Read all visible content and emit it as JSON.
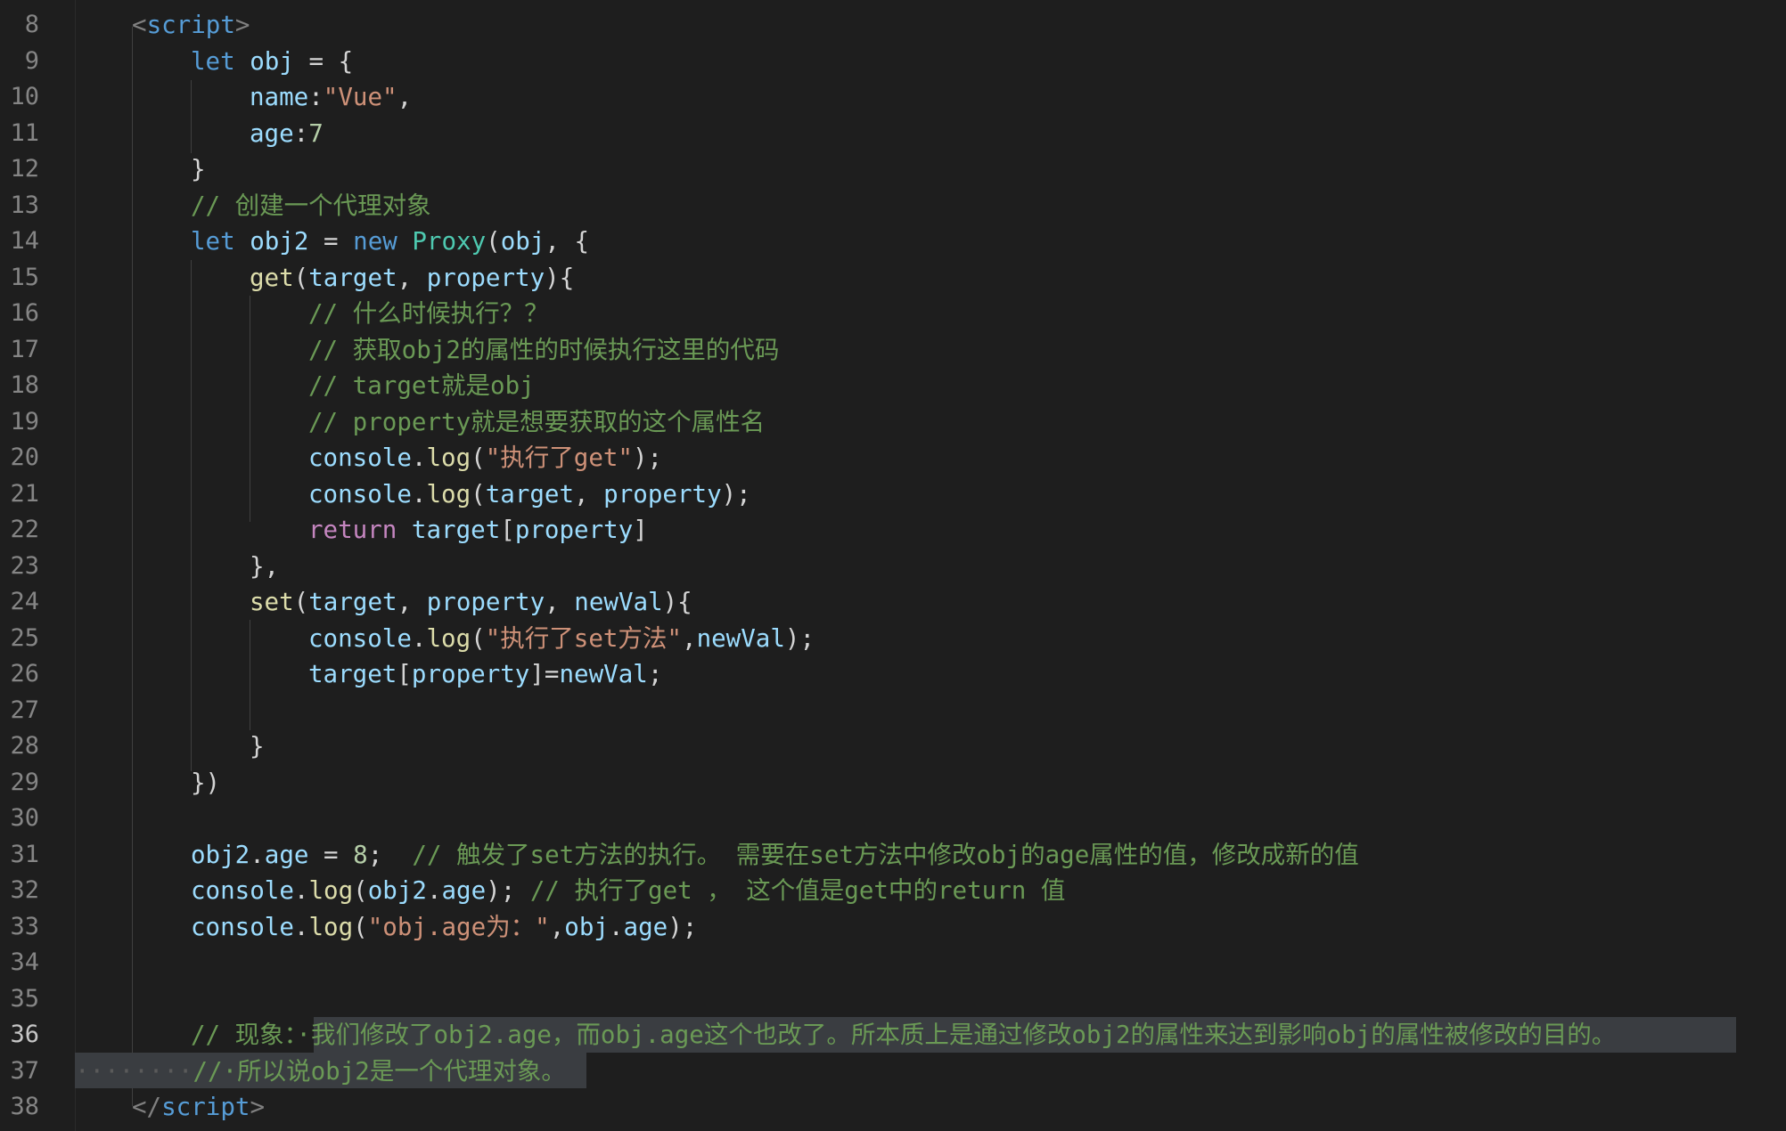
{
  "line_numbers": [
    "8",
    "9",
    "10",
    "11",
    "12",
    "13",
    "14",
    "15",
    "16",
    "17",
    "18",
    "19",
    "20",
    "21",
    "22",
    "23",
    "24",
    "25",
    "26",
    "27",
    "28",
    "29",
    "30",
    "31",
    "32",
    "33",
    "34",
    "35",
    "36",
    "37",
    "38"
  ],
  "active_line": "36",
  "code": {
    "l8_tag": "script",
    "l8_open": "<",
    "l8_close": ">",
    "let": "let",
    "obj": "obj",
    "eq_brace": " = {",
    "name_key": "name",
    "colon": ":",
    "vue_str": "\"Vue\"",
    "comma": ",",
    "age_key": "age",
    "age_val": "7",
    "close_brace": "}",
    "c13": "// 创建一个代理对象",
    "obj2": "obj2",
    "eq": " = ",
    "new_kw": "new",
    "proxy": "Proxy",
    "proxy_args_open": "(",
    "proxy_args_rest": ", {",
    "get_fn": "get",
    "target": "target",
    "property": "property",
    "get_params_open": "(",
    "params_sep": ", ",
    "get_params_close": "){",
    "c16": "// 什么时候执行？？",
    "c17": "// 获取obj2的属性的时候执行这里的代码",
    "c18": "// target就是obj",
    "c19": "// property就是想要获取的这个属性名",
    "console": "console",
    "dot": ".",
    "log": "log",
    "paren_open": "(",
    "paren_close_semi": ");",
    "s20": "\"执行了get\"",
    "return_kw": "return",
    "bracket_open": "[",
    "bracket_close": "]",
    "l23": "},",
    "set_fn": "set",
    "newVal": "newVal",
    "set_params_close": "){",
    "s25": "\"执行了set方法\"",
    "eq_tight": "=",
    "semi": ";",
    "l29": "})",
    "age_prop": "age",
    "eight": "8",
    "c31": "// 触发了set方法的执行。 需要在set方法中修改obj的age属性的值，修改成新的值",
    "paren_close": ")",
    "c32": "// 执行了get ， 这个值是get中的return 值",
    "s33": "\"obj.age为：\"",
    "c36_lead": "// 现象：",
    "c36_sel": "·我们修改了obj2.age，而obj.age这个也改了。所本质上是通过修改obj2的属性来达到影响obj的属性被修改的目的。",
    "l37_dots": "········",
    "c37": "//·所以说obj2是一个代理对象。",
    "l38_close": "</",
    "space": " "
  },
  "colors": {
    "background": "#1e1e1e",
    "keyword": "#569cd6",
    "control_keyword": "#c586c0",
    "variable": "#9cdcfe",
    "function": "#dcdcaa",
    "class": "#4ec9b0",
    "string": "#ce9178",
    "number": "#b5cea8",
    "comment": "#6a9955",
    "selection": "#3a3d41"
  }
}
